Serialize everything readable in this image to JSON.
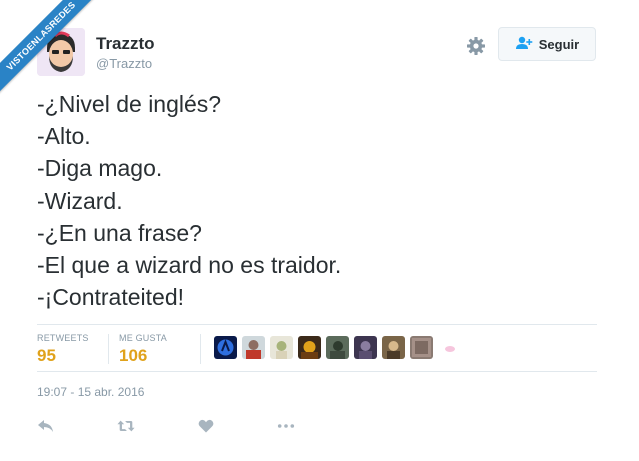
{
  "watermark": {
    "text": "VISTOENLASREDES"
  },
  "tweet": {
    "author": {
      "display_name": "Trazzto",
      "handle": "@Trazzto"
    },
    "follow_label": "Seguir",
    "lines": [
      "-¿Nivel de inglés?",
      "-Alto.",
      "-Diga mago.",
      "-Wizard.",
      "-¿En una frase?",
      "-El que a wizard no es traidor.",
      "-¡Contrateited!"
    ],
    "stats": {
      "retweets_label": "RETWEETS",
      "retweets_value": "95",
      "likes_label": "ME GUSTA",
      "likes_value": "106"
    },
    "timestamp": "19:07 - 15 abr. 2016"
  },
  "colors": {
    "accent": "#e0a21b",
    "watermark_bg": "#2a83c6",
    "muted_text": "#8899a6",
    "follow_icon": "#1da1f2"
  },
  "icons": {
    "gear": "gear-icon",
    "follow": "person-plus-icon",
    "reply": "reply-icon",
    "retweet": "retweet-icon",
    "like": "heart-icon",
    "more": "more-dots-icon"
  }
}
